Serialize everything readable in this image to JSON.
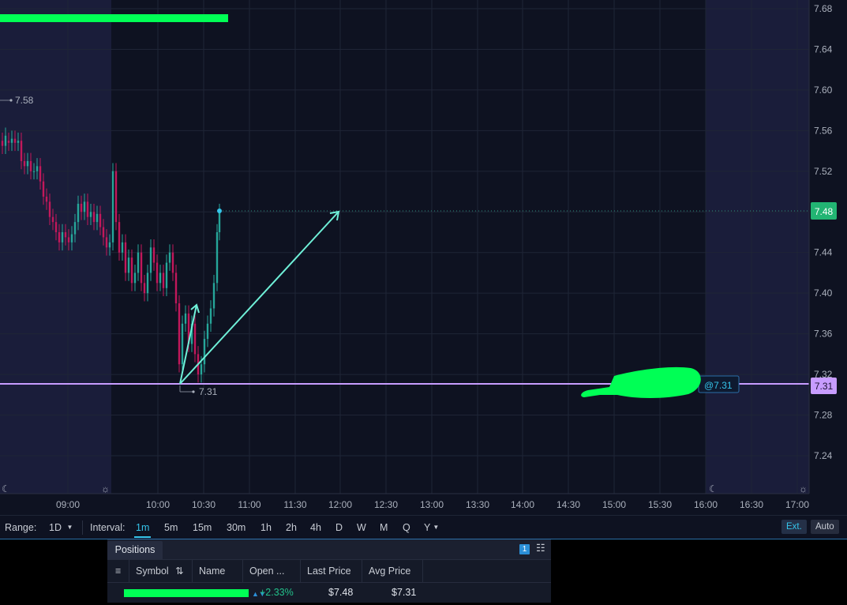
{
  "chart": {
    "price_axis": [
      "7.68",
      "7.64",
      "7.60",
      "7.56",
      "7.52",
      "7.48",
      "7.44",
      "7.40",
      "7.36",
      "7.32",
      "7.28",
      "7.24"
    ],
    "time_axis": [
      "09:00",
      "10:00",
      "10:30",
      "11:00",
      "11:30",
      "12:00",
      "12:30",
      "13:00",
      "13:30",
      "14:00",
      "14:30",
      "15:00",
      "15:30",
      "16:00",
      "16:30",
      "17:00"
    ],
    "last_price_tag": "7.48",
    "avg_price_tag": "7.31",
    "order_line_label": "@7.31",
    "high_marker": "7.58",
    "low_marker": "7.31",
    "colors": {
      "background": "#0e1221",
      "extended_hours": "#1a1d3a",
      "up": "#26a69a",
      "down": "#c2185b",
      "last_price": "#22b573",
      "avg_line": "#c79cff",
      "arrows": "#6ff0d8",
      "redaction": "#00ff55"
    }
  },
  "toolbar": {
    "range_label": "Range:",
    "range_value": "1D",
    "interval_label": "Interval:",
    "intervals": [
      "1m",
      "5m",
      "15m",
      "30m",
      "1h",
      "2h",
      "4h",
      "D",
      "W",
      "M",
      "Q",
      "Y"
    ],
    "active_interval": "1m",
    "ext_label": "Ext.",
    "auto_label": "Auto"
  },
  "positions": {
    "tab_title": "Positions",
    "count_badge": "1",
    "columns": [
      "Symbol",
      "Name",
      "Open ...",
      "Last Price",
      "Avg Price"
    ],
    "row": {
      "open_pl": "+2.33%",
      "last_price": "$7.48",
      "avg_price": "$7.31"
    }
  }
}
